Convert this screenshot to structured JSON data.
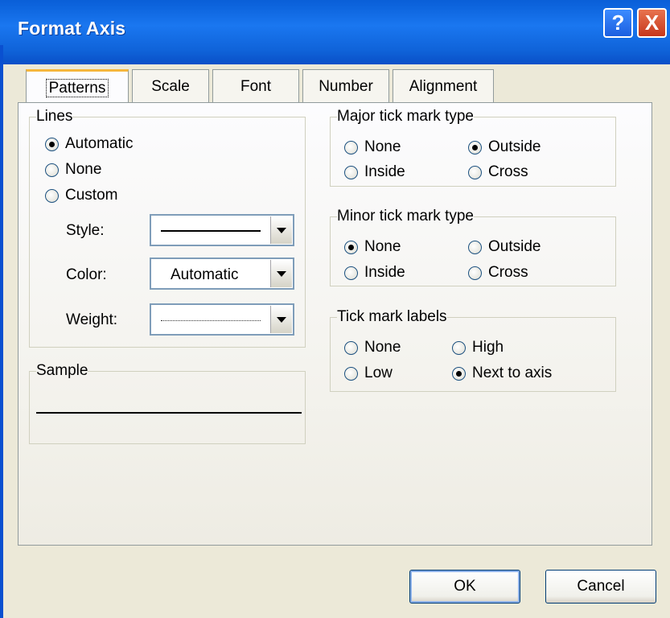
{
  "window": {
    "title": "Format Axis"
  },
  "titlebar_buttons": {
    "help": "?",
    "close": "X"
  },
  "tabs": [
    {
      "label": "Patterns",
      "active": true
    },
    {
      "label": "Scale",
      "active": false
    },
    {
      "label": "Font",
      "active": false
    },
    {
      "label": "Number",
      "active": false
    },
    {
      "label": "Alignment",
      "active": false
    }
  ],
  "lines": {
    "legend": "Lines",
    "options": [
      "Automatic",
      "None",
      "Custom"
    ],
    "selected": "Automatic",
    "style_label": "Style:",
    "color_label": "Color:",
    "color_value": "Automatic",
    "weight_label": "Weight:"
  },
  "sample": {
    "legend": "Sample"
  },
  "major": {
    "legend": "Major tick mark type",
    "options": [
      "None",
      "Outside",
      "Inside",
      "Cross"
    ],
    "selected": "Outside"
  },
  "minor": {
    "legend": "Minor tick mark type",
    "options": [
      "None",
      "Outside",
      "Inside",
      "Cross"
    ],
    "selected": "None"
  },
  "labels": {
    "legend": "Tick mark labels",
    "options": [
      "None",
      "High",
      "Low",
      "Next to axis"
    ],
    "selected": "Next to axis"
  },
  "buttons": {
    "ok": "OK",
    "cancel": "Cancel"
  },
  "colors": {
    "titlebar": "#0c63dc",
    "face": "#ece9d8",
    "tab_highlight": "#f5b63c"
  }
}
